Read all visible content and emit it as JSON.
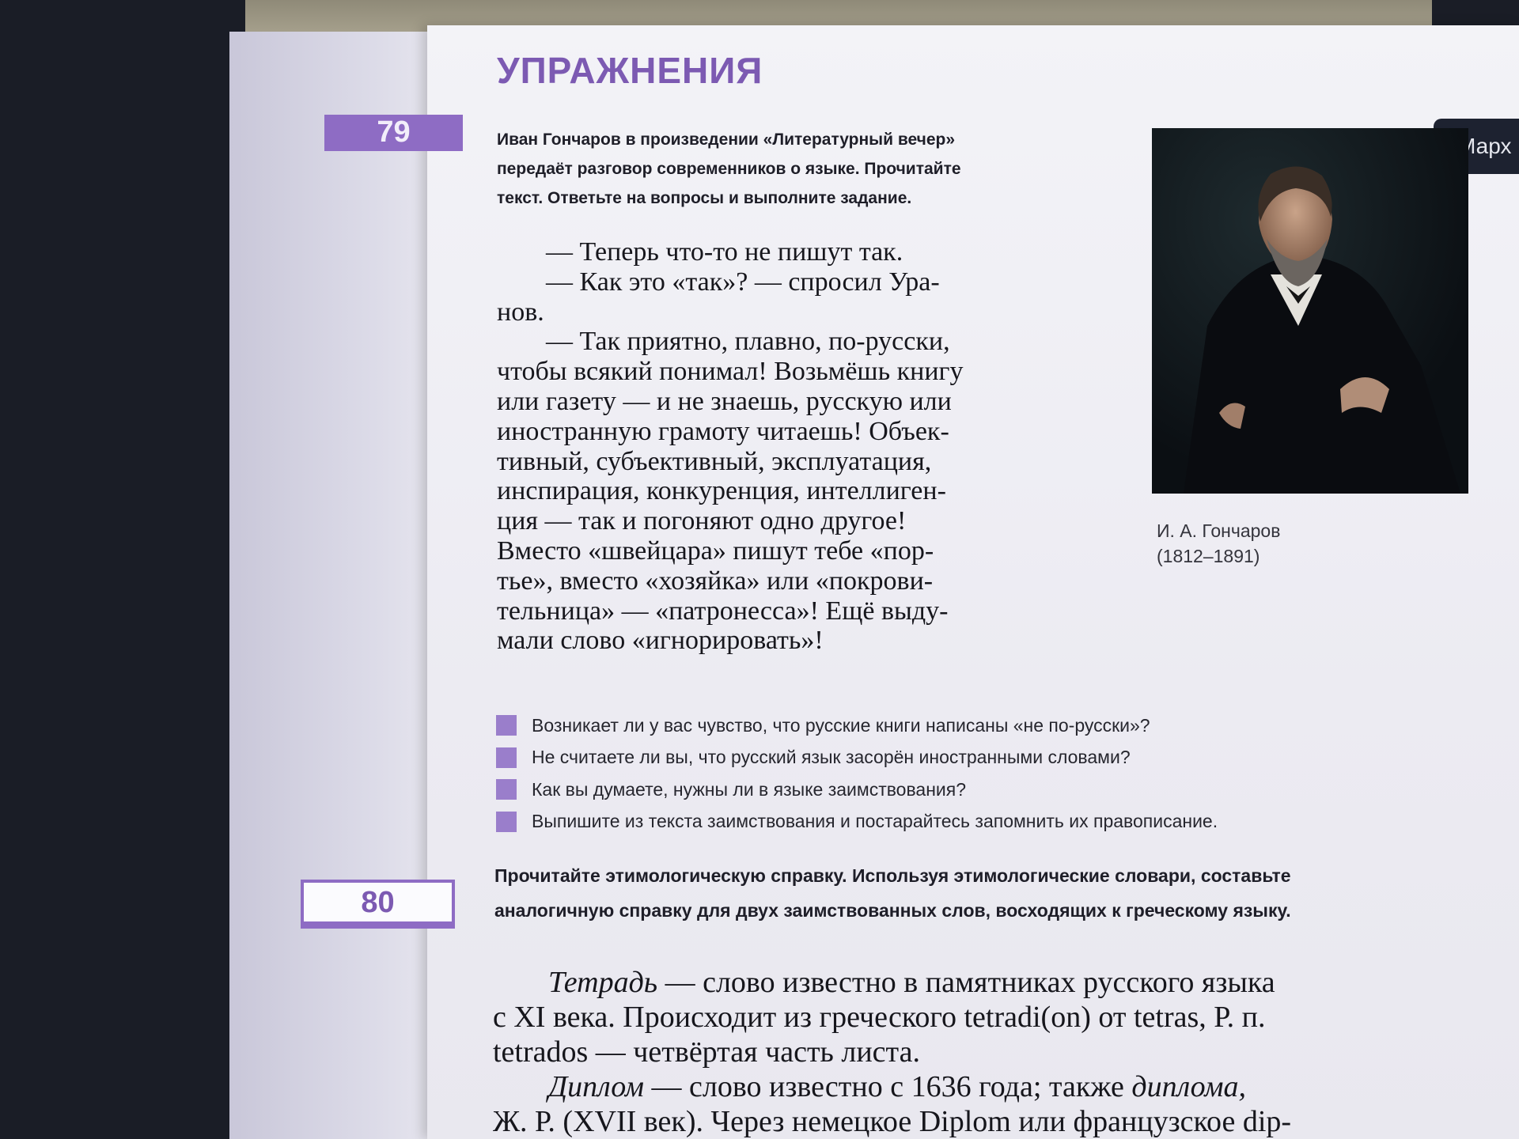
{
  "section_title": "УПРАЖНЕНИЯ",
  "side_tab_label": "Марх",
  "exercise_79": {
    "number": "79",
    "task_lines": [
      "Иван Гончаров в произведении «Литературный вечер»",
      "передаёт разговор современников о языке. Прочитайте",
      "текст. Ответьте на вопросы и выполните задание."
    ],
    "passage_lines": [
      "— Теперь что-то не пишут так.",
      "— Как это «так»? — спросил Ура-",
      "нов.",
      "— Так приятно, плавно, по-русски,",
      "чтобы всякий понимал! Возьмёшь книгу",
      "или газету — и не знаешь, русскую или",
      "иностранную грамоту читаешь! Объек-",
      "тивный, субъективный, эксплуатация,",
      "инспирация, конкуренция, интеллиген-",
      "ция — так и погоняют одно другое!",
      "Вместо «швейцара» пишут тебе «пор-",
      "тье», вместо «хозяйка» или «покрови-",
      "тельница» — «патронесса»! Ещё выду-",
      "мали слово «игнорировать»!"
    ],
    "portrait_caption_name": "И. А. Гончаров",
    "portrait_caption_years": "(1812–1891)",
    "questions": [
      "Возникает ли у вас чувство, что русские книги написаны «не по-русски»?",
      "Не считаете ли вы, что русский язык засорён иностранными словами?",
      "Как вы думаете, нужны ли в языке заимствования?",
      "Выпишите из текста заимствования и постарайтесь запомнить их правописание."
    ]
  },
  "exercise_80": {
    "number": "80",
    "task_lines": [
      "Прочитайте этимологическую справку. Используя этимологические словари, составьте",
      "аналогичную справку для двух заимствованных слов, восходящих к греческому языку."
    ],
    "entry1": {
      "term": "Тетрадь",
      "line1_rest": " — слово известно в памятниках русского языка",
      "line2": "с XI века. Происходит из греческого tetradi(on) от tetras, Р. п.",
      "line3": "tetrados — четвёртая часть листа."
    },
    "entry2": {
      "term": "Диплом",
      "line1_mid": " — слово известно с 1636 года; также ",
      "line1_italic": "диплома,",
      "line2": "Ж. Р. (XVII век). Через немецкое Diplom или французское dip-"
    }
  },
  "colors": {
    "accent_purple": "#8e6cc4",
    "title_purple": "#7c5ab2",
    "page_bg": "#f0eff5",
    "text": "#16161c"
  }
}
